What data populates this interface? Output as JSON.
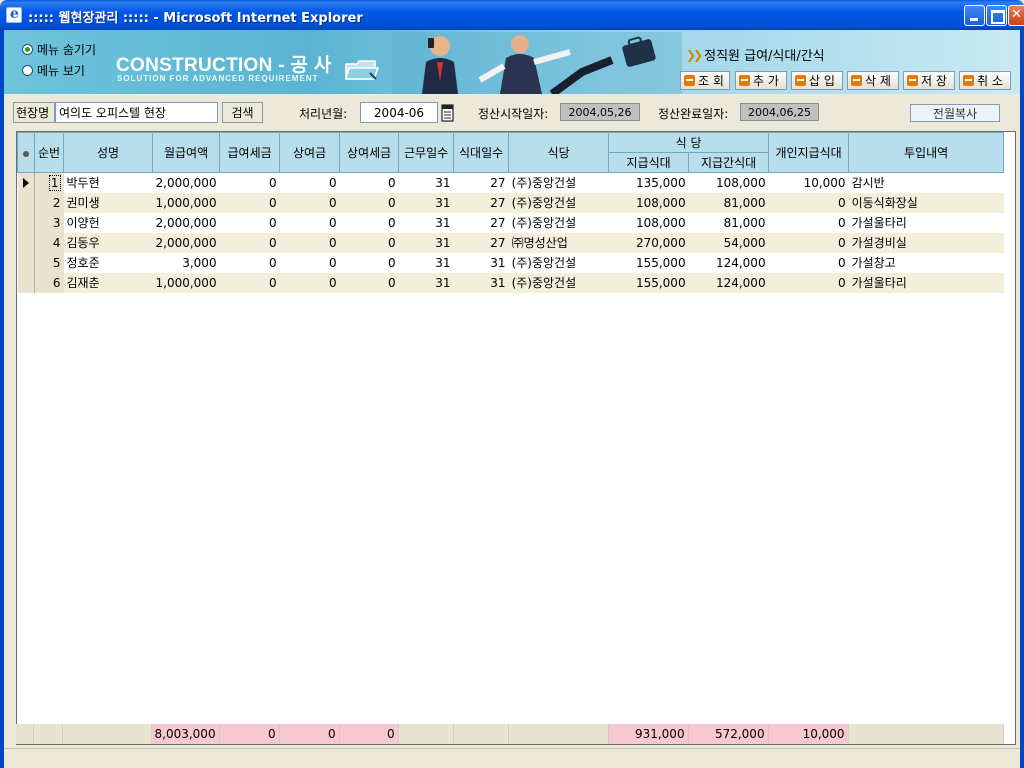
{
  "window": {
    "title": "::::: 웹현장관리 ::::: - Microsoft Internet Explorer"
  },
  "menu_toggle": {
    "hide_label": "메뉴 숨기기",
    "show_label": "메뉴 보기",
    "selected": "hide"
  },
  "banner": {
    "brand": "CONSTRUCTION - 공 사",
    "tagline": "SOLUTION FOR ADVANCED REQUIREMENT",
    "page_heading": "정직원 급여/식대/간식"
  },
  "toolbar": {
    "query": "조 회",
    "add": "추 가",
    "insert": "삽 입",
    "delete": "삭 제",
    "save": "저 장",
    "cancel": "취 소"
  },
  "colors": {
    "query": "#E07B00",
    "add": "#E07B00",
    "insert": "#E07B00",
    "delete": "#E07B00",
    "save": "#E07B00",
    "cancel": "#E07B00"
  },
  "search": {
    "site_label": "현장명",
    "site_value": "여의도 오피스텔 현장",
    "search_button": "검색",
    "period_label": "처리년월:",
    "period_value": "2004-06",
    "start_label": "정산시작일자:",
    "start_value": "2004,05,26",
    "end_label": "정산완료일자:",
    "end_value": "2004,06,25",
    "copy_button": "전월복사"
  },
  "grid": {
    "headers": {
      "seq": "순번",
      "name": "성명",
      "salary": "월급여액",
      "salary_tax": "급여세금",
      "bonus": "상여금",
      "bonus_tax": "상여세금",
      "work_days": "근무일수",
      "meal_days": "식대일수",
      "canteen": "식당",
      "meal_group": "식 당",
      "meal_pay": "지급식대",
      "snack_pay": "지급간식대",
      "personal_meal": "개인지급식대",
      "assignment": "투입내역"
    },
    "rows": [
      {
        "seq": "1",
        "name": "박두현",
        "salary": "2,000,000",
        "salary_tax": "0",
        "bonus": "0",
        "bonus_tax": "0",
        "work_days": "31",
        "meal_days": "27",
        "canteen": "(주)중앙건설",
        "meal_pay": "135,000",
        "snack_pay": "108,000",
        "personal_meal": "10,000",
        "assignment": "감시반"
      },
      {
        "seq": "2",
        "name": "권미생",
        "salary": "1,000,000",
        "salary_tax": "0",
        "bonus": "0",
        "bonus_tax": "0",
        "work_days": "31",
        "meal_days": "27",
        "canteen": "(주)중앙건설",
        "meal_pay": "108,000",
        "snack_pay": "81,000",
        "personal_meal": "0",
        "assignment": "이동식화장실"
      },
      {
        "seq": "3",
        "name": "이양헌",
        "salary": "2,000,000",
        "salary_tax": "0",
        "bonus": "0",
        "bonus_tax": "0",
        "work_days": "31",
        "meal_days": "27",
        "canteen": "(주)중앙건설",
        "meal_pay": "108,000",
        "snack_pay": "81,000",
        "personal_meal": "0",
        "assignment": "가설울타리"
      },
      {
        "seq": "4",
        "name": "김동우",
        "salary": "2,000,000",
        "salary_tax": "0",
        "bonus": "0",
        "bonus_tax": "0",
        "work_days": "31",
        "meal_days": "27",
        "canteen": "㈜명성산업",
        "meal_pay": "270,000",
        "snack_pay": "54,000",
        "personal_meal": "0",
        "assignment": "가설경비실"
      },
      {
        "seq": "5",
        "name": "정호준",
        "salary": "3,000",
        "salary_tax": "0",
        "bonus": "0",
        "bonus_tax": "0",
        "work_days": "31",
        "meal_days": "31",
        "canteen": "(주)중앙건설",
        "meal_pay": "155,000",
        "snack_pay": "124,000",
        "personal_meal": "0",
        "assignment": "가설창고"
      },
      {
        "seq": "6",
        "name": "김재춘",
        "salary": "1,000,000",
        "salary_tax": "0",
        "bonus": "0",
        "bonus_tax": "0",
        "work_days": "31",
        "meal_days": "31",
        "canteen": "(주)중앙건설",
        "meal_pay": "155,000",
        "snack_pay": "124,000",
        "personal_meal": "0",
        "assignment": "가설울타리"
      }
    ],
    "totals": {
      "salary": "8,003,000",
      "salary_tax": "0",
      "bonus": "0",
      "bonus_tax": "0",
      "meal_pay": "931,000",
      "snack_pay": "572,000",
      "personal_meal": "10,000"
    }
  }
}
